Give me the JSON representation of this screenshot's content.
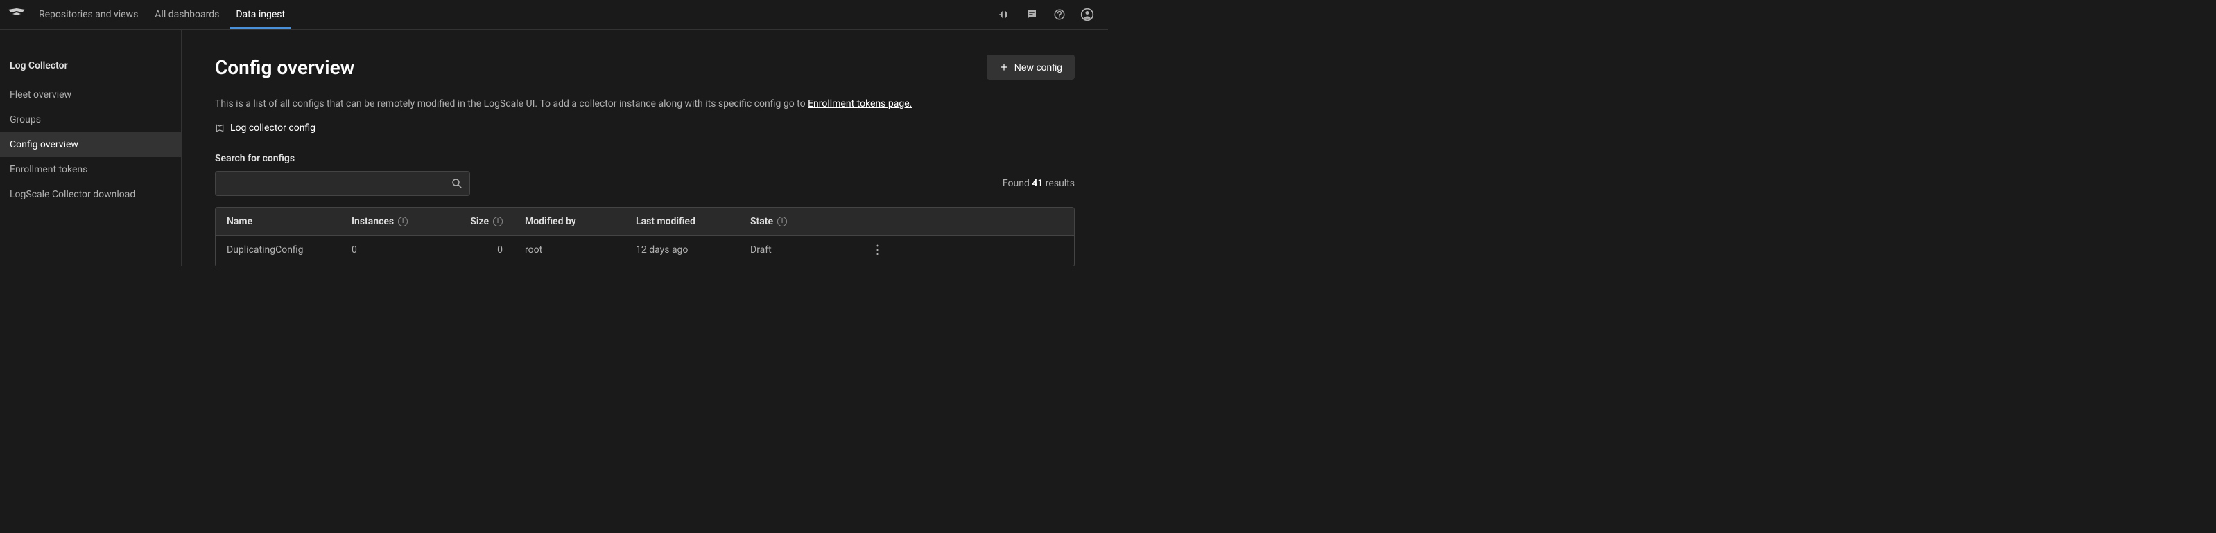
{
  "topNav": {
    "items": [
      {
        "label": "Repositories and views"
      },
      {
        "label": "All dashboards"
      },
      {
        "label": "Data ingest"
      }
    ]
  },
  "sidebar": {
    "heading": "Log Collector",
    "items": [
      {
        "label": "Fleet overview"
      },
      {
        "label": "Groups"
      },
      {
        "label": "Config overview"
      },
      {
        "label": "Enrollment tokens"
      },
      {
        "label": "LogScale Collector download"
      }
    ]
  },
  "page": {
    "title": "Config overview",
    "newConfigLabel": "New config",
    "descriptionPrefix": "This is a list of all configs that can be remotely modified in the LogScale UI. To add a collector instance along with its specific config go to ",
    "enrollmentLink": "Enrollment tokens page.",
    "docLink": "Log collector config",
    "searchLabel": "Search for configs",
    "searchPlaceholder": "",
    "resultsPrefix": "Found ",
    "resultsCount": "41",
    "resultsSuffix": " results"
  },
  "table": {
    "headers": {
      "name": "Name",
      "instances": "Instances",
      "size": "Size",
      "modifiedBy": "Modified by",
      "lastModified": "Last modified",
      "state": "State"
    },
    "rows": [
      {
        "name": "DuplicatingConfig",
        "instances": "0",
        "size": "0",
        "modifiedBy": "root",
        "lastModified": "12 days ago",
        "state": "Draft"
      }
    ]
  }
}
